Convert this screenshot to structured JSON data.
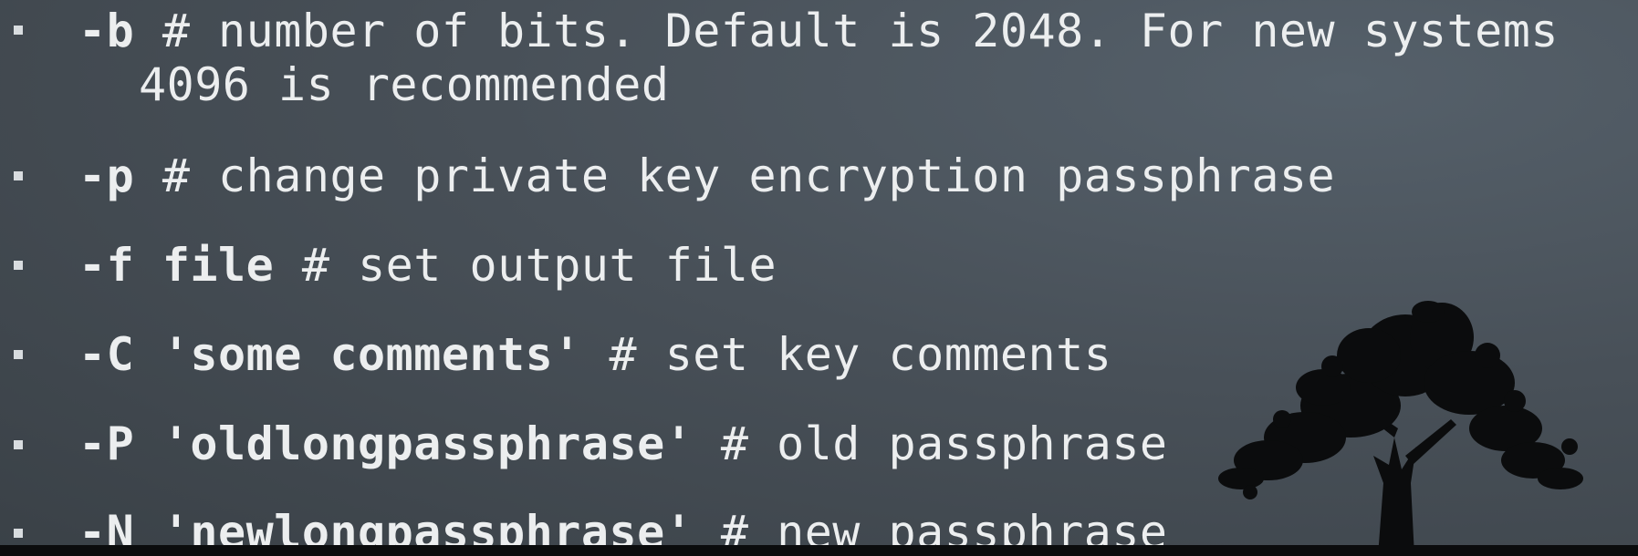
{
  "options": [
    {
      "flag": "-b",
      "arg": "",
      "comment": "# number of bits. Default is 2048. For new systems",
      "comment_cont": "4096 is recommended"
    },
    {
      "flag": "-p",
      "arg": "",
      "comment": "# change private key encryption passphrase"
    },
    {
      "flag": "-f",
      "arg": "file",
      "comment": "# set output file"
    },
    {
      "flag": "-C",
      "arg": "'some comments'",
      "comment": "# set key comments"
    },
    {
      "flag": "-P",
      "arg": "'oldlongpassphrase'",
      "comment": "# old passphrase"
    },
    {
      "flag": "-N",
      "arg": "'newlongpassphrase'",
      "comment": "# new passphrase"
    }
  ],
  "colors": {
    "text": "#eceeef",
    "background": "#485058",
    "tree": "#0b0c0d"
  },
  "icons": {
    "bullet": "square-bullet-icon",
    "decoration": "tree-silhouette"
  }
}
